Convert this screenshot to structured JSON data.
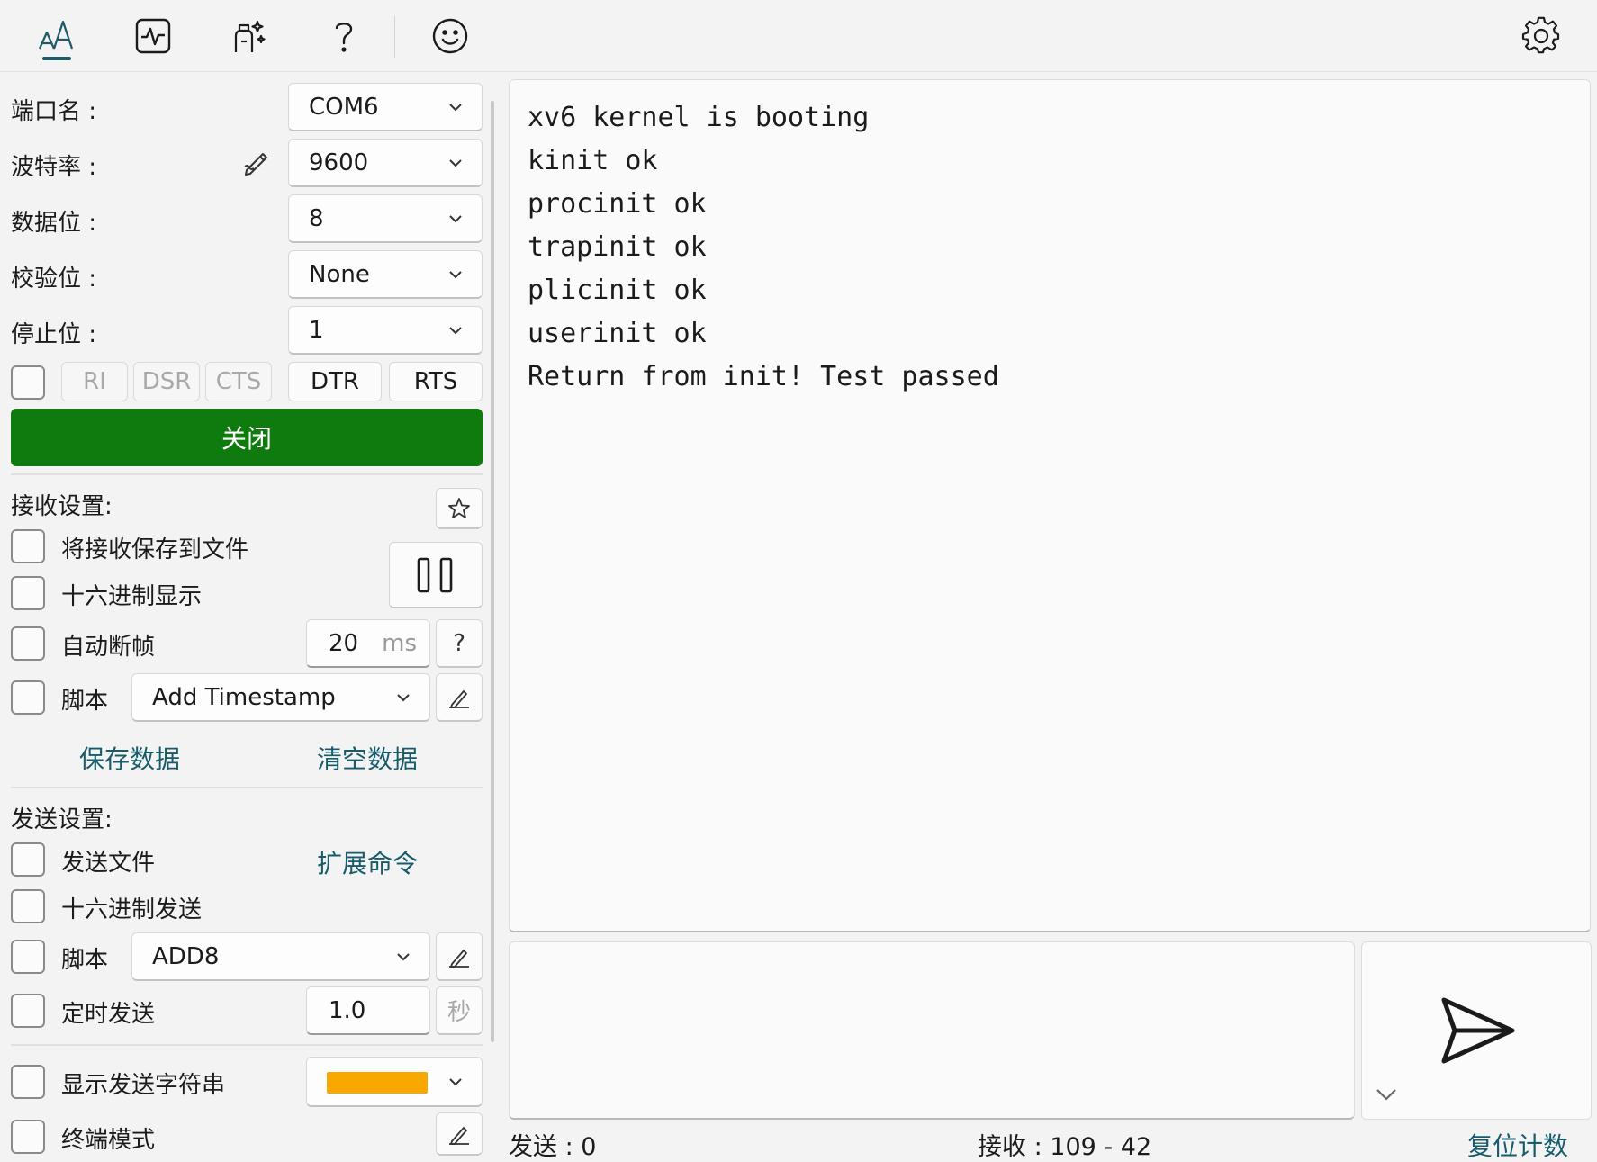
{
  "toolbar": {
    "icons": [
      "font-size-icon",
      "activity-monitor-icon",
      "magic-brush-icon",
      "help-icon",
      "smiley-icon",
      "settings-icon"
    ]
  },
  "serial": {
    "port_label": "端口名 :",
    "port_value": "COM6",
    "baud_label": "波特率 :",
    "baud_value": "9600",
    "databits_label": "数据位 :",
    "databits_value": "8",
    "parity_label": "校验位 :",
    "parity_value": "None",
    "stopbits_label": "停止位 :",
    "stopbits_value": "1",
    "signals": [
      "RI",
      "DSR",
      "CTS"
    ],
    "dtr_label": "DTR",
    "rts_label": "RTS",
    "close_label": "关闭",
    "close_color": "#0f7b0f"
  },
  "receive": {
    "section_label": "接收设置:",
    "save_to_file": "将接收保存到文件",
    "hex_display": "十六进制显示",
    "auto_frame": "自动断帧",
    "frame_value": "20",
    "frame_unit": "ms",
    "frame_help": "?",
    "script_label": "脚本",
    "script_value": "Add Timestamp",
    "save_data": "保存数据",
    "clear_data": "清空数据"
  },
  "send": {
    "section_label": "发送设置:",
    "send_file": "发送文件",
    "ext_cmd": "扩展命令",
    "hex_send": "十六进制发送",
    "script_label": "脚本",
    "script_value": "ADD8",
    "timed_send": "定时发送",
    "timed_value": "1.0",
    "timed_unit": "秒",
    "show_send_string": "显示发送字符串",
    "show_send_color": "#f8a800",
    "terminal_mode": "终端模式"
  },
  "terminal": {
    "lines": [
      "xv6 kernel is booting",
      "kinit ok",
      "procinit ok",
      "trapinit ok",
      "plicinit ok",
      "userinit ok",
      "Return from init! Test passed"
    ]
  },
  "status": {
    "sent_label": "发送 :",
    "sent_value": "0",
    "recv_label": "接收 :",
    "recv_value": "109",
    "recv_sep": "-",
    "recv_value2": "42",
    "reset_label": "复位计数"
  }
}
